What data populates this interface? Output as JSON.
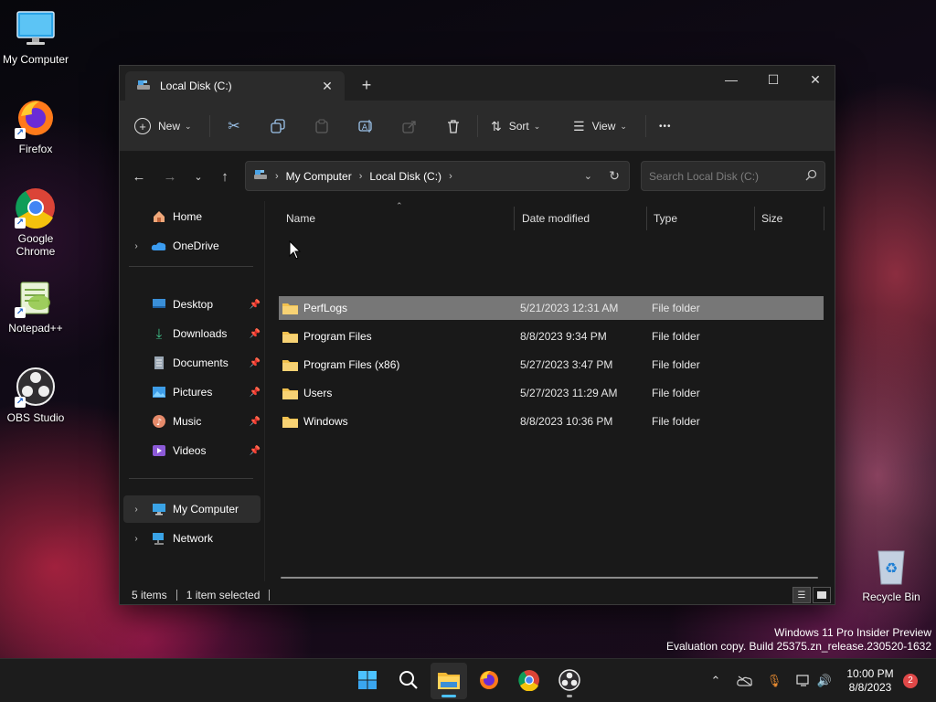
{
  "colors": {
    "accent": "#4cc2ff",
    "folder": "#f2c14e",
    "selected_row": "#777777",
    "window_bg": "#191919",
    "toolbar_bg": "#2b2b2b",
    "taskbar_bg": "#1c1c1c",
    "notification_badge": "#e04848"
  },
  "desktop": {
    "icons": [
      {
        "label": "My Computer",
        "icon": "monitor-icon"
      },
      {
        "label": "Firefox",
        "icon": "firefox-icon"
      },
      {
        "label": "Google Chrome",
        "icon": "chrome-icon"
      },
      {
        "label": "Notepad++",
        "icon": "notepadpp-icon"
      },
      {
        "label": "OBS Studio",
        "icon": "obs-icon"
      },
      {
        "label": "Recycle Bin",
        "icon": "recycle-bin-icon"
      }
    ]
  },
  "window": {
    "tab_title": "Local Disk (C:)",
    "new_tab": "+",
    "controls": {
      "minimize": "—",
      "maximize": "☐",
      "close": "✕"
    }
  },
  "toolbar": {
    "new_label": "New",
    "sort_label": "Sort",
    "view_label": "View",
    "more_label": "•••"
  },
  "address": {
    "breadcrumbs": [
      "My Computer",
      "Local Disk (C:)"
    ],
    "search_placeholder": "Search Local Disk (C:)"
  },
  "nav": {
    "home": "Home",
    "onedrive": "OneDrive",
    "quick_access": [
      {
        "label": "Desktop",
        "icon": "desktop-icon"
      },
      {
        "label": "Downloads",
        "icon": "downloads-icon"
      },
      {
        "label": "Documents",
        "icon": "documents-icon"
      },
      {
        "label": "Pictures",
        "icon": "pictures-icon"
      },
      {
        "label": "Music",
        "icon": "music-icon"
      },
      {
        "label": "Videos",
        "icon": "videos-icon"
      }
    ],
    "my_computer": "My Computer",
    "network": "Network"
  },
  "filelist": {
    "columns": [
      "Name",
      "Date modified",
      "Type",
      "Size"
    ],
    "rows": [
      {
        "name": "PerfLogs",
        "date": "5/21/2023 12:31 AM",
        "type": "File folder",
        "selected": true
      },
      {
        "name": "Program Files",
        "date": "8/8/2023 9:34 PM",
        "type": "File folder",
        "selected": false
      },
      {
        "name": "Program Files (x86)",
        "date": "5/27/2023 3:47 PM",
        "type": "File folder",
        "selected": false
      },
      {
        "name": "Users",
        "date": "5/27/2023 11:29 AM",
        "type": "File folder",
        "selected": false
      },
      {
        "name": "Windows",
        "date": "8/8/2023 10:36 PM",
        "type": "File folder",
        "selected": false
      }
    ]
  },
  "status": {
    "items_count": "5 items",
    "selection": "1 item selected"
  },
  "watermark": {
    "line1": "Windows 11 Pro Insider Preview",
    "line2": "Evaluation copy. Build 25375.zn_release.230520-1632"
  },
  "taskbar": {
    "apps": [
      "start-icon",
      "search-icon",
      "file-explorer-icon",
      "firefox-icon",
      "chrome-icon",
      "obs-icon"
    ],
    "time": "10:00 PM",
    "date": "8/8/2023",
    "notification_count": "2"
  }
}
